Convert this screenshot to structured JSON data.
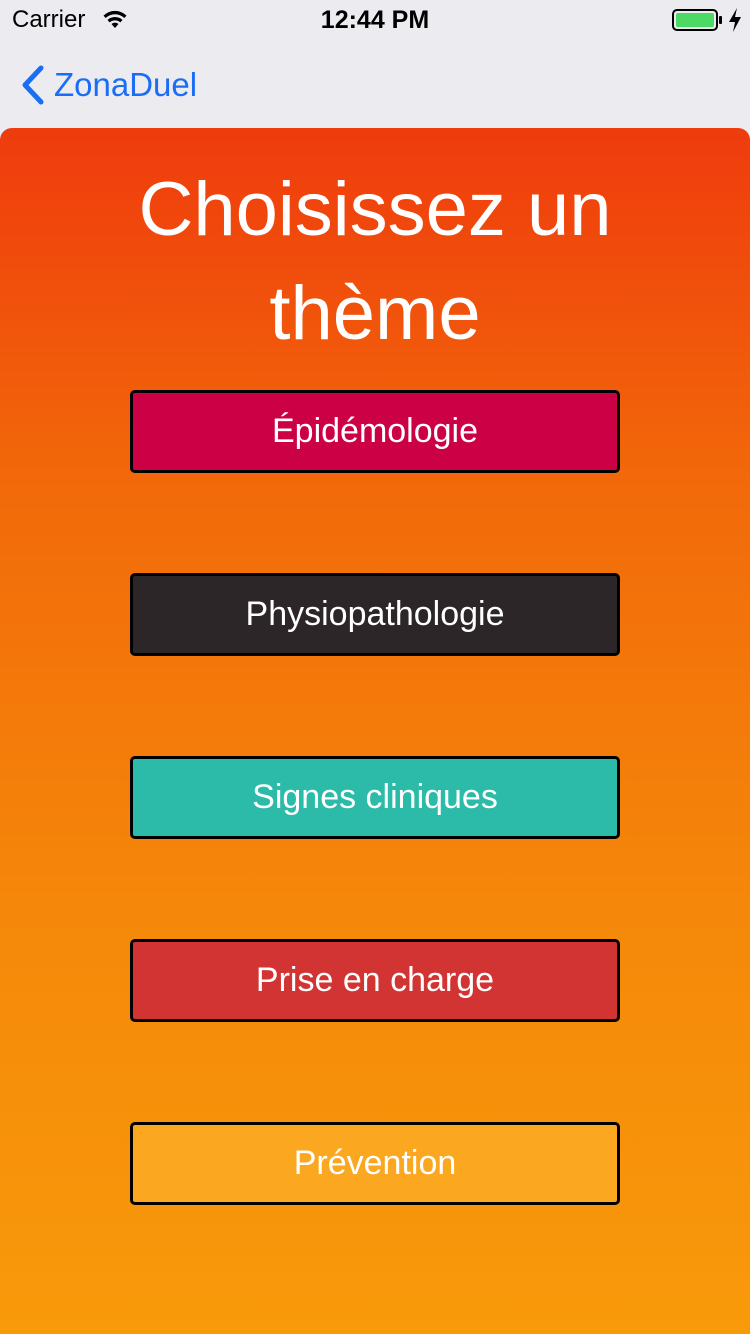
{
  "status_bar": {
    "carrier": "Carrier",
    "time": "12:44 PM",
    "battery_color": "#4cd964"
  },
  "nav": {
    "back_label": "ZonaDuel",
    "tint_color": "#1a6ef5"
  },
  "panel": {
    "title": "Choisissez un thème",
    "gradient_top": "#ef3b0d",
    "gradient_bottom": "#f89a0a"
  },
  "themes": [
    {
      "label": "Épidémologie",
      "color": "#cc0044"
    },
    {
      "label": "Physiopathologie",
      "color": "#2c2628"
    },
    {
      "label": "Signes cliniques",
      "color": "#2bbba8"
    },
    {
      "label": "Prise en charge",
      "color": "#d23433"
    },
    {
      "label": "Prévention",
      "color": "#fba71f"
    }
  ]
}
